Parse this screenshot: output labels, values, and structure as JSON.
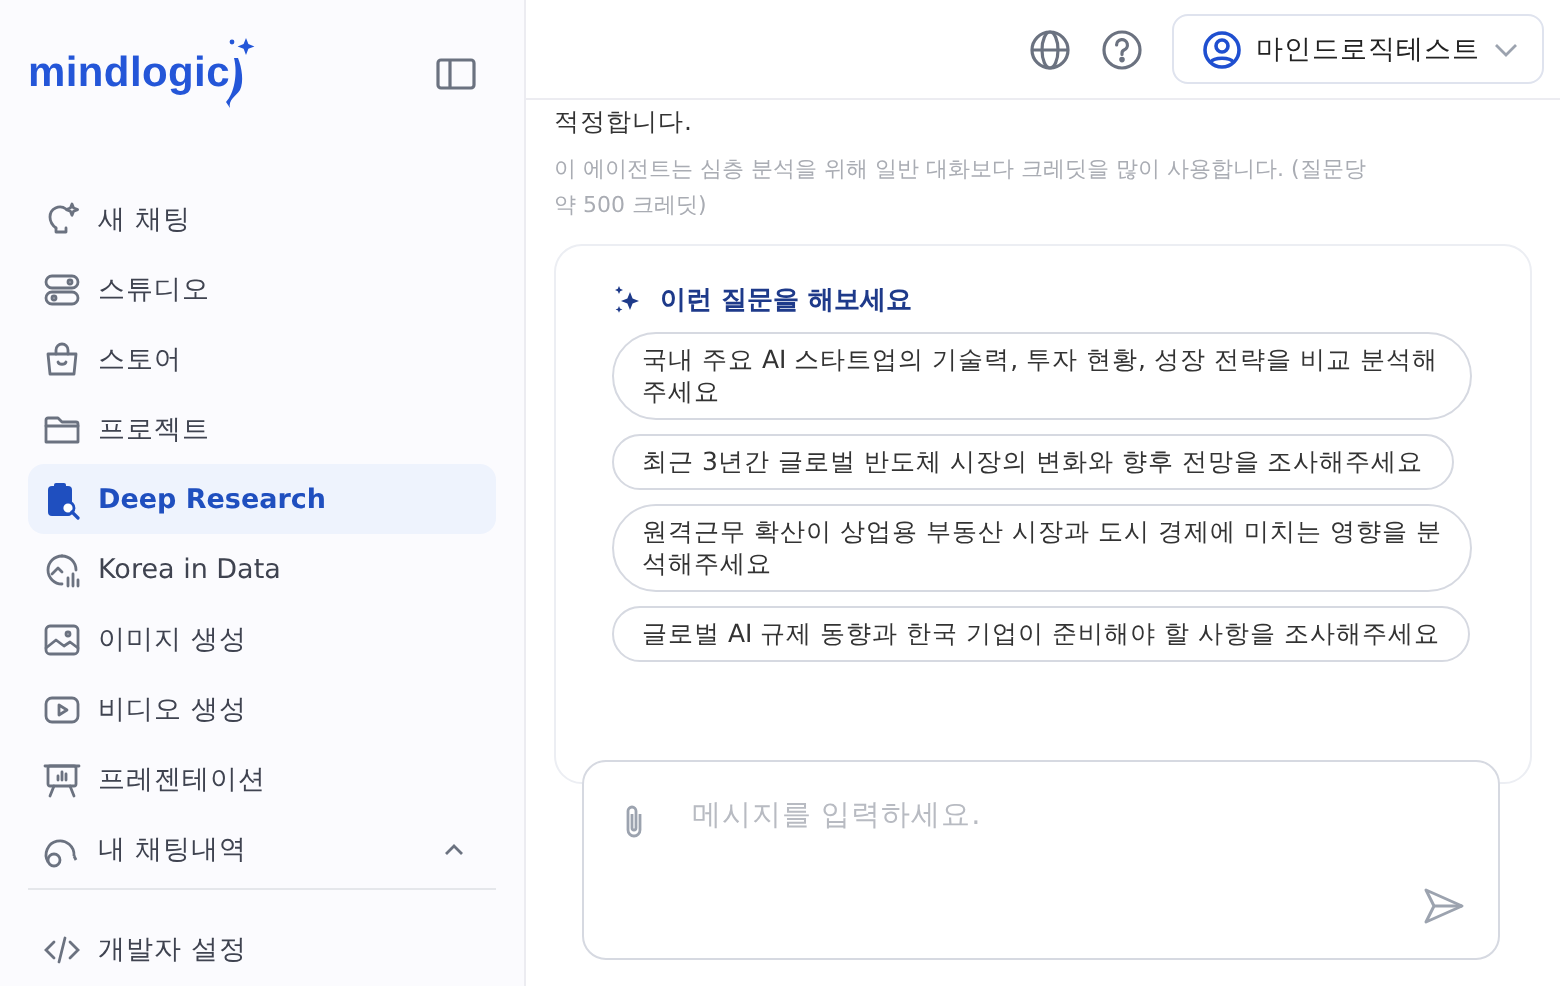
{
  "sidebar": {
    "logo": "mindlogic",
    "items": [
      {
        "label": "새 채팅",
        "selected": false
      },
      {
        "label": "스튜디오",
        "selected": false
      },
      {
        "label": "스토어",
        "selected": false
      },
      {
        "label": "프로젝트",
        "selected": false
      },
      {
        "label": "Deep Research",
        "selected": true
      },
      {
        "label": "Korea in Data",
        "selected": false
      },
      {
        "label": "이미지 생성",
        "selected": false
      },
      {
        "label": "비디오 생성",
        "selected": false
      },
      {
        "label": "프레젠테이션",
        "selected": false
      }
    ],
    "history": {
      "label": "내 채팅내역",
      "expanded": true
    },
    "developer": {
      "label": "개발자 설정"
    }
  },
  "header": {
    "user": "마인드로직테스트"
  },
  "content": {
    "intro_tail": "적정합니다.",
    "note": "이 에이전트는 심층 분석을 위해 일반 대화보다 크레딧을 많이 사용합니다. (질문당 약 500 크레딧)",
    "suggestions": {
      "title": "이런 질문을 해보세요",
      "items": [
        "국내 주요 AI 스타트업의 기술력, 투자 현황, 성장 전략을 비교 분석해주세요",
        "최근 3년간 글로벌 반도체 시장의 변화와 향후 전망을 조사해주세요",
        "원격근무 확산이 상업용 부동산 시장과 도시 경제에 미치는 영향을 분석해주세요",
        "글로벌 AI 규제 동향과 한국 기업이 준비해야 할 사항을 조사해주세요"
      ]
    }
  },
  "composer": {
    "placeholder": "메시지를 입력하세요."
  }
}
